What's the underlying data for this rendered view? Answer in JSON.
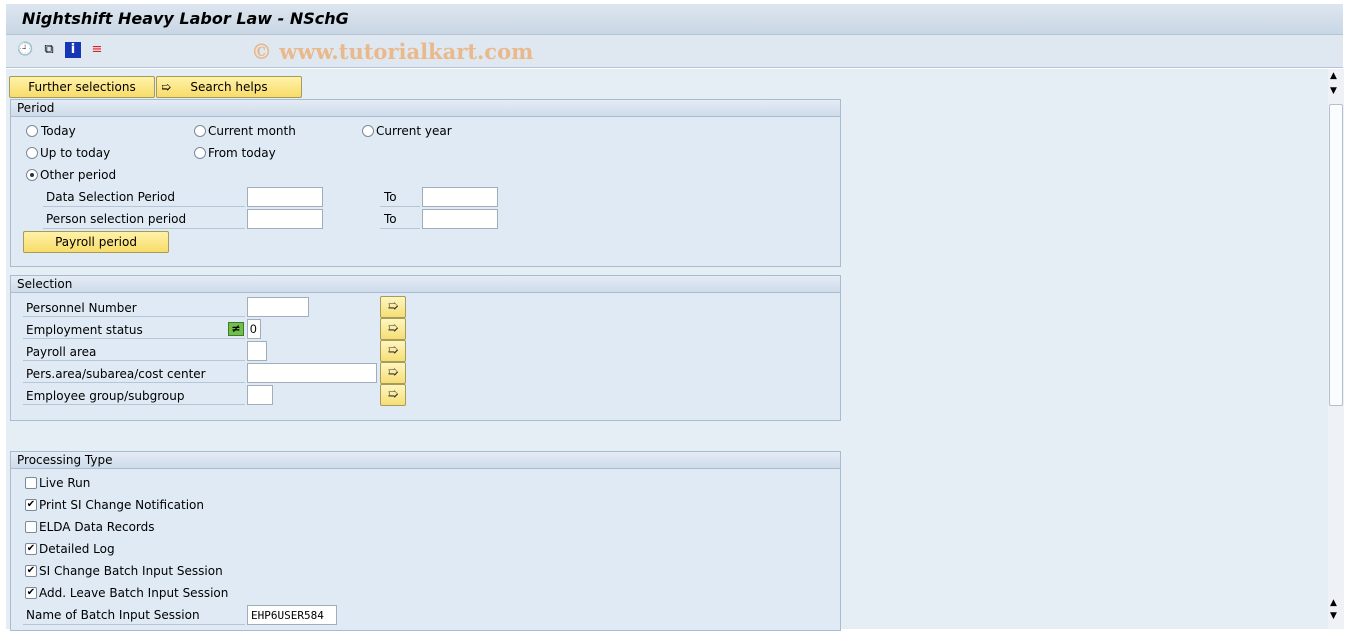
{
  "window": {
    "title": "Nightshift Heavy Labor Law - NSchG",
    "watermark": "© www.tutorialkart.com"
  },
  "toolbar": {
    "icons": [
      "execute-clock-icon",
      "get-variant-icon",
      "info-icon",
      "selection-options-icon"
    ]
  },
  "buttons": {
    "further_selections": "Further selections",
    "search_helps": "Search helps",
    "payroll_period": "Payroll period"
  },
  "period": {
    "title": "Period",
    "radios": [
      {
        "label": "Today",
        "selected": false
      },
      {
        "label": "Current month",
        "selected": false
      },
      {
        "label": "Current year",
        "selected": false
      },
      {
        "label": "Up to today",
        "selected": false
      },
      {
        "label": "From today",
        "selected": false
      },
      {
        "label": "Other period",
        "selected": true
      }
    ],
    "data_selection_label": "Data Selection Period",
    "person_selection_label": "Person selection period",
    "to_label": "To",
    "data_from": "",
    "data_to": "",
    "person_from": "",
    "person_to": ""
  },
  "selection": {
    "title": "Selection",
    "fields": [
      {
        "label": "Personnel Number",
        "value": ""
      },
      {
        "label": "Employment status",
        "value": "0",
        "option_icon": "not-equal"
      },
      {
        "label": "Payroll area",
        "value": ""
      },
      {
        "label": "Pers.area/subarea/cost center",
        "value": ""
      },
      {
        "label": "Employee group/subgroup",
        "value": ""
      }
    ]
  },
  "processing": {
    "title": "Processing Type",
    "checks": [
      {
        "label": "Live Run",
        "checked": false
      },
      {
        "label": "Print SI Change Notification",
        "checked": true
      },
      {
        "label": "ELDA Data Records",
        "checked": false
      },
      {
        "label": "Detailed Log",
        "checked": true
      },
      {
        "label": "SI Change Batch Input Session",
        "checked": true
      },
      {
        "label": "Add. Leave Batch Input Session",
        "checked": true
      }
    ],
    "session_label": "Name of Batch Input Session",
    "session_value": "EHP6USER584"
  },
  "colors": {
    "button": "#f8dc6a",
    "group_bg": "#dfeaf4",
    "watermark": "#e9b98c",
    "status_green": "#6fbf4a"
  }
}
